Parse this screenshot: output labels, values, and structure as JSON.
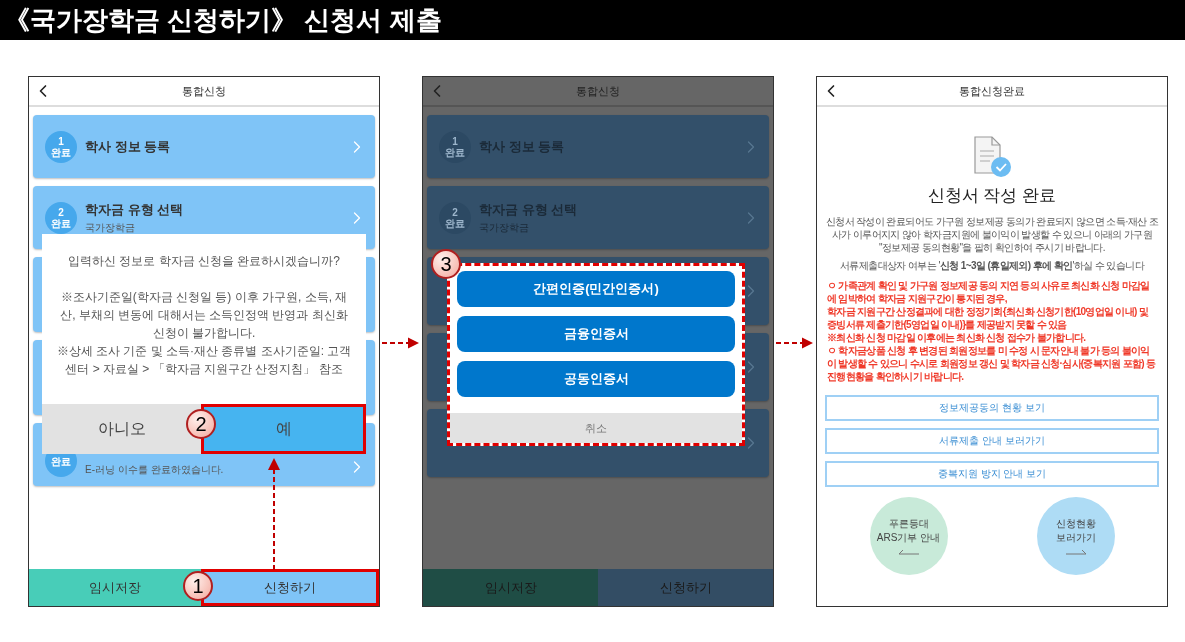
{
  "title": "《국가장학금 신청하기》 신청서 제출",
  "screens": [
    {
      "kind": "confirm",
      "dimmed": false,
      "header": "통합신청",
      "cards": [
        {
          "kind": "step",
          "number": "1",
          "status": "완료",
          "title": "학사 정보 등록"
        },
        {
          "kind": "step",
          "number": "2",
          "status": "완료",
          "title": "학자금 유형 선택",
          "subtitle": "국가장학금"
        },
        {
          "kind": "blank"
        },
        {
          "kind": "blank"
        },
        {
          "kind": "step",
          "status": "완료",
          "subtitle": "E-러닝 이수를 완료하였습니다."
        }
      ],
      "dialog": {
        "message": "입력하신 정보로 학자금 신청을 완료하시겠습니까?",
        "notes": [
          "※조사기준일(학자금 신청일 등) 이후 가구원, 소득, 재산, 부채의 변동에 대해서는 소득인정액 반영과 최신화 신청이 불가합니다.",
          "※상세 조사 기준 및 소득·재산 종류별 조사기준일: 고객센터 > 자료실 > 「학자금 지원구간 산정지침」 참조"
        ],
        "buttons": [
          {
            "label": "아니오",
            "primary": false,
            "highlighted": false
          },
          {
            "label": "예",
            "primary": true,
            "highlighted": true,
            "step": "2"
          }
        ]
      },
      "bottom_buttons": [
        {
          "label": "임시저장",
          "kind": "save",
          "highlighted": false
        },
        {
          "label": "신청하기",
          "kind": "submit",
          "highlighted": true,
          "step": "1"
        }
      ]
    },
    {
      "kind": "auth",
      "dimmed": true,
      "header": "통합신청",
      "cards": [
        {
          "kind": "step",
          "number": "1",
          "status": "완료",
          "title": "학사 정보 등록"
        },
        {
          "kind": "step",
          "number": "2",
          "status": "완료",
          "title": "학자금 유형 선택",
          "subtitle": "국가장학금"
        },
        {
          "kind": "covered"
        },
        {
          "kind": "covered"
        },
        {
          "kind": "covered"
        }
      ],
      "dialog": {
        "step": "3",
        "options": [
          "간편인증(민간인증서)",
          "금융인증서",
          "공동인증서"
        ],
        "cancel": "취소"
      },
      "bottom_buttons": [
        {
          "label": "임시저장",
          "kind": "save",
          "highlighted": false
        },
        {
          "label": "신청하기",
          "kind": "submit",
          "highlighted": false
        }
      ]
    },
    {
      "kind": "complete",
      "header": "통합신청완료",
      "heading": "신청서 작성 완료",
      "paragraphs": [
        "신청서 작성이 완료되어도 가구원 정보제공 동의가 완료되지 않으면 소득·재산 조사가 이루어지지 않아 학자금지원에 불이익이 발생할 수 있으니 아래의 가구원 \"정보제공 동의현황\"을 필히 확인하여 주시기 바랍니다.",
        "서류제출대상자 여부는 '**신청 1~3일 (휴일제외) 후에 확인**'하실 수 있습니다"
      ],
      "notices": [
        "ㅇ 가족관계 확인 및 가구원 정보제공 동의 지연 등의 사유로 최신화 신청 마감일에 임박하여 학자금 지원구간이 통지된 경우,",
        "학자금 지원구간 산정결과에 대한 정정기회{최신화 신청기한(10영업일 이내) 및 증빙서류 제출기한(5영업일 이내)}를 제공받지 못할 수 있음",
        "※최신화 신청 마감일 이후에는 최신화 신청 접수가 불가합니다.",
        "ㅇ 학자금상품 신청 후 변경된 회원정보를 미 수정 시 문자안내 불가 등의 불이익이 발생할 수 있으니 수시로 회원정보 갱신 및 학자금 신청·심사(중복지원 포함) 등 진행현황을 확인하시기 바랍니다."
      ],
      "links": [
        "정보제공동의 현황 보기",
        "서류제출 안내 보러가기",
        "중복지원 방지 안내 보기"
      ],
      "circles": [
        {
          "lines": [
            "푸른등대",
            "ARS기부 안내"
          ],
          "color": "#c8ead9",
          "kind": "back"
        },
        {
          "lines": [
            "신청현황",
            "보러가기"
          ],
          "color": "#aedcf5",
          "kind": "forward"
        }
      ]
    }
  ]
}
